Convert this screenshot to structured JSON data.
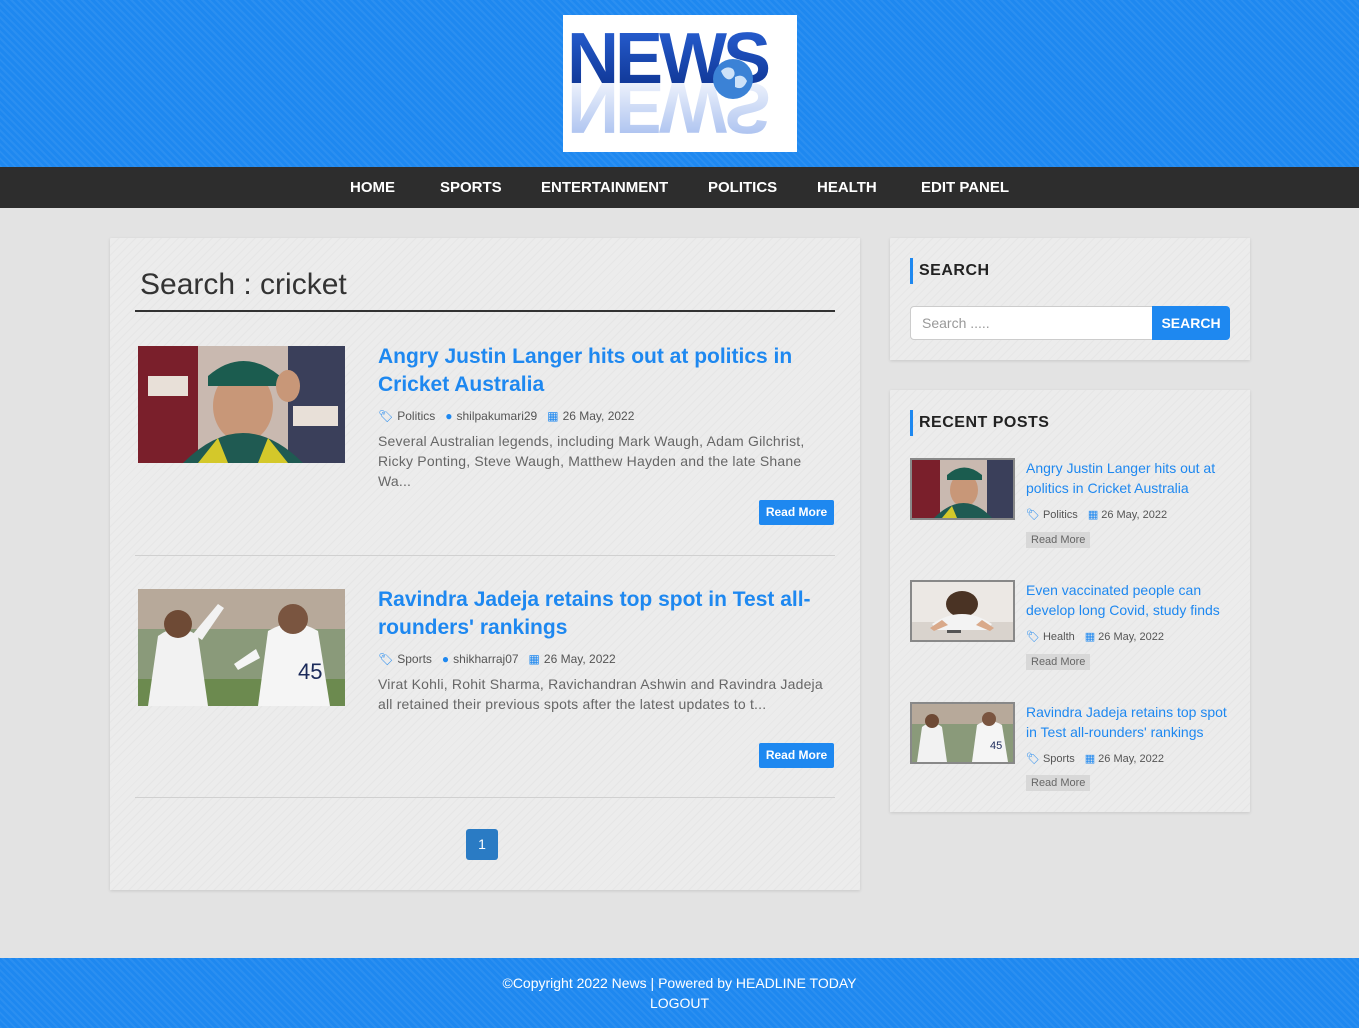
{
  "brand": {
    "logo_text": "NEWS"
  },
  "nav": {
    "items": [
      {
        "label": "HOME"
      },
      {
        "label": "SPORTS"
      },
      {
        "label": "ENTERTAINMENT"
      },
      {
        "label": "POLITICS"
      },
      {
        "label": "HEALTH"
      },
      {
        "label": "EDIT PANEL"
      }
    ]
  },
  "main": {
    "heading": "Search : cricket",
    "posts": [
      {
        "title": "Angry Justin Langer hits out at politics in Cricket Australia",
        "category": "Politics",
        "author": "shilpakumari29",
        "date": "26 May, 2022",
        "excerpt": "Several Australian legends, including Mark Waugh, Adam Gilchrist, Ricky Ponting, Steve Waugh, Matthew Hayden and the late Shane Wa...",
        "read_more": "Read More"
      },
      {
        "title": "Ravindra Jadeja retains top spot in Test all-rounders' rankings",
        "category": "Sports",
        "author": "shikharraj07",
        "date": "26 May, 2022",
        "excerpt": "Virat Kohli, Rohit Sharma, Ravichandran Ashwin and Ravindra Jadeja all retained their previous spots after the latest updates to t...",
        "read_more": "Read More"
      }
    ],
    "pagination": {
      "current": "1"
    }
  },
  "sidebar": {
    "search": {
      "title": "SEARCH",
      "placeholder": "Search .....",
      "button": "SEARCH"
    },
    "recent": {
      "title": "RECENT POSTS",
      "items": [
        {
          "title": "Angry Justin Langer hits out at politics in Cricket Australia",
          "category": "Politics",
          "date": "26 May, 2022",
          "read_more": "Read More"
        },
        {
          "title": "Even vaccinated people can develop long Covid, study finds",
          "category": "Health",
          "date": "26 May, 2022",
          "read_more": "Read More"
        },
        {
          "title": "Ravindra Jadeja retains top spot in Test all-rounders' rankings",
          "category": "Sports",
          "date": "26 May, 2022",
          "read_more": "Read More"
        }
      ]
    }
  },
  "footer": {
    "copyright": "©Copyright 2022 News | Powered by HEADLINE TODAY",
    "logout": "LOGOUT"
  },
  "colors": {
    "primary": "#1e88f0",
    "nav_bg": "#2d2d2d",
    "page_bg": "#e3e3e3",
    "pagination_bg": "#2a7bc4"
  },
  "icons": {
    "category": "tag-icon",
    "author": "user-icon",
    "date": "calendar-icon"
  }
}
